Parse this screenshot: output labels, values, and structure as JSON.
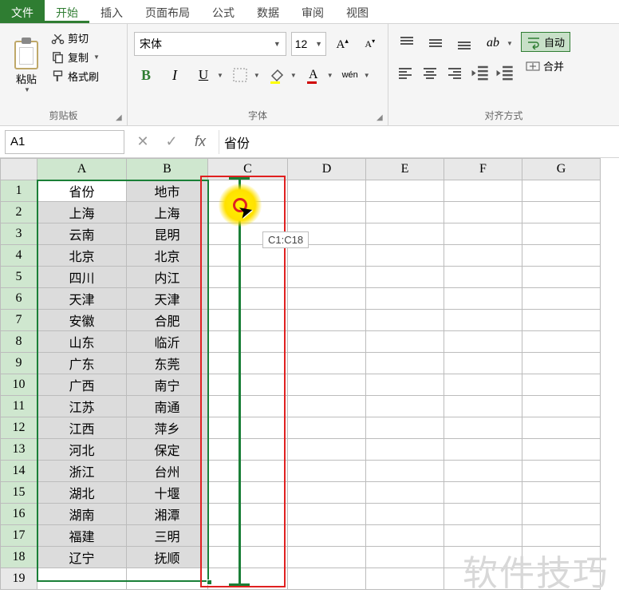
{
  "tabs": {
    "file": "文件",
    "home": "开始",
    "insert": "插入",
    "layout": "页面布局",
    "formula": "公式",
    "data": "数据",
    "review": "审阅",
    "view": "视图"
  },
  "ribbon": {
    "clipboard": {
      "paste": "粘贴",
      "cut": "剪切",
      "copy": "复制",
      "format_painter": "格式刷",
      "title": "剪贴板"
    },
    "font": {
      "name": "宋体",
      "size": "12",
      "increase": "A",
      "decrease": "A",
      "bold": "B",
      "italic": "I",
      "underline": "U",
      "pinyin": "wén",
      "title": "字体"
    },
    "align": {
      "title": "对齐方式",
      "wrap": "自动",
      "merge": "合并"
    }
  },
  "namebox": "A1",
  "formula": "省份",
  "columns": [
    "A",
    "B",
    "C",
    "D",
    "E",
    "F",
    "G"
  ],
  "headers": {
    "a": "省份",
    "b": "地市"
  },
  "rows": [
    {
      "a": "上海",
      "b": "上海"
    },
    {
      "a": "云南",
      "b": "昆明"
    },
    {
      "a": "北京",
      "b": "北京"
    },
    {
      "a": "四川",
      "b": "内江"
    },
    {
      "a": "天津",
      "b": "天津"
    },
    {
      "a": "安徽",
      "b": "合肥"
    },
    {
      "a": "山东",
      "b": "临沂"
    },
    {
      "a": "广东",
      "b": "东莞"
    },
    {
      "a": "广西",
      "b": "南宁"
    },
    {
      "a": "江苏",
      "b": "南通"
    },
    {
      "a": "江西",
      "b": "萍乡"
    },
    {
      "a": "河北",
      "b": "保定"
    },
    {
      "a": "浙江",
      "b": "台州"
    },
    {
      "a": "湖北",
      "b": "十堰"
    },
    {
      "a": "湖南",
      "b": "湘潭"
    },
    {
      "a": "福建",
      "b": "三明"
    },
    {
      "a": "辽宁",
      "b": "抚顺"
    }
  ],
  "range_tooltip": "C1:C18",
  "watermark": "软件技巧"
}
